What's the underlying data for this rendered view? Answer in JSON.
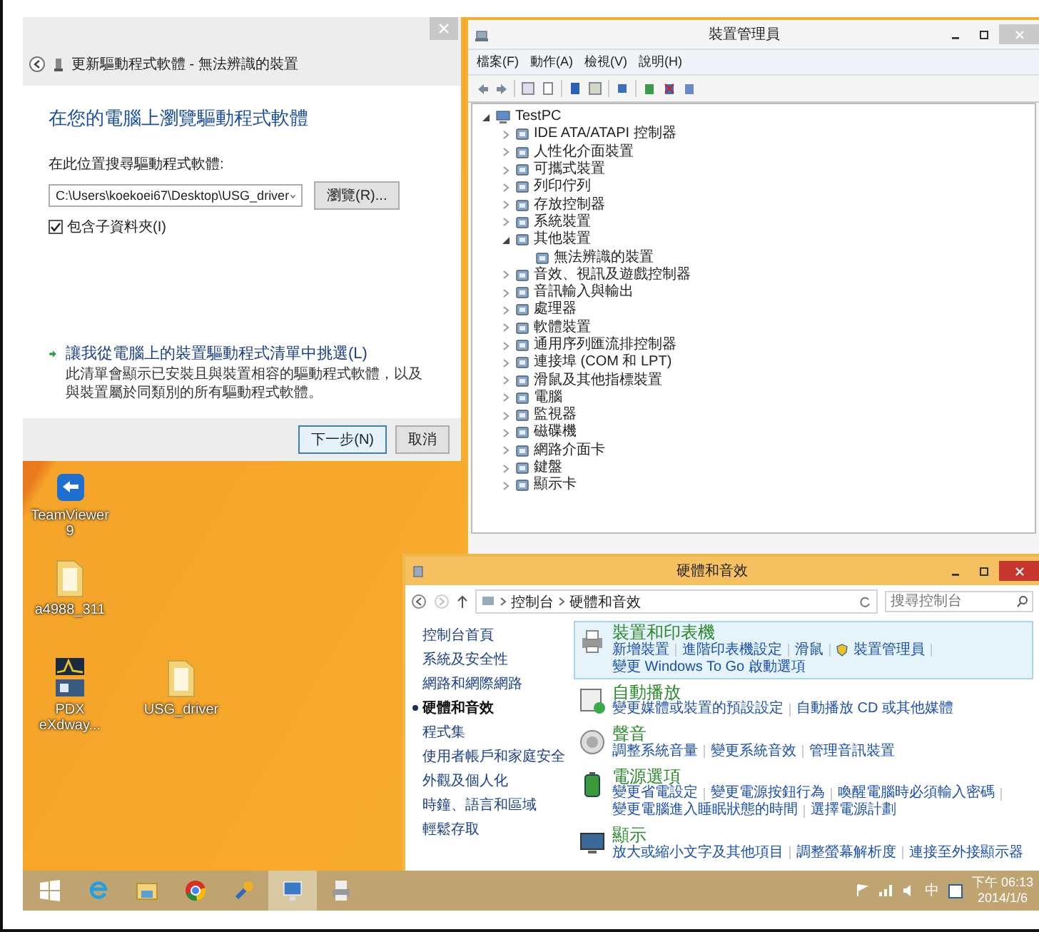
{
  "driver_wizard": {
    "title": "更新驅動程式軟體 - 無法辨識的裝置",
    "heading": "在您的電腦上瀏覽驅動程式軟體",
    "search_label": "在此位置搜尋驅動程式軟體:",
    "path": "C:\\Users\\koekoei67\\Desktop\\USG_driver",
    "browse_button": "瀏覽(R)...",
    "include_subfolders": {
      "label": "包含子資料夾(I)",
      "checked": true
    },
    "pick_link": "讓我從電腦上的裝置驅動程式清單中挑選(L)",
    "pick_description": "此清單會顯示已安裝且與裝置相容的驅動程式軟體，以及與裝置屬於同類別的所有驅動程式軟體。",
    "buttons": [
      {
        "label": "下一步(N)",
        "kind": "primary"
      },
      {
        "label": "取消",
        "kind": "normal"
      }
    ]
  },
  "device_manager": {
    "title": "裝置管理員",
    "menu": [
      "檔案(F)",
      "動作(A)",
      "檢視(V)",
      "說明(H)"
    ],
    "tree": {
      "label": "TestPC",
      "expanded": true,
      "children": [
        {
          "label": "IDE ATA/ATAPI 控制器",
          "expanded": false
        },
        {
          "label": "人性化介面裝置",
          "expanded": false
        },
        {
          "label": "可攜式裝置",
          "expanded": false
        },
        {
          "label": "列印佇列",
          "expanded": false
        },
        {
          "label": "存放控制器",
          "expanded": false
        },
        {
          "label": "系統裝置",
          "expanded": false
        },
        {
          "label": "其他裝置",
          "expanded": true,
          "children": [
            {
              "label": "無法辨識的裝置"
            }
          ]
        },
        {
          "label": "音效、視訊及遊戲控制器",
          "expanded": false
        },
        {
          "label": "音訊輸入與輸出",
          "expanded": false
        },
        {
          "label": "處理器",
          "expanded": false
        },
        {
          "label": "軟體裝置",
          "expanded": false
        },
        {
          "label": "通用序列匯流排控制器",
          "expanded": false
        },
        {
          "label": "連接埠 (COM 和 LPT)",
          "expanded": false
        },
        {
          "label": "滑鼠及其他指標裝置",
          "expanded": false
        },
        {
          "label": "電腦",
          "expanded": false
        },
        {
          "label": "監視器",
          "expanded": false
        },
        {
          "label": "磁碟機",
          "expanded": false
        },
        {
          "label": "網路介面卡",
          "expanded": false
        },
        {
          "label": "鍵盤",
          "expanded": false
        },
        {
          "label": "顯示卡",
          "expanded": false
        }
      ]
    }
  },
  "control_panel": {
    "title": "硬體和音效",
    "breadcrumb": [
      "控制台",
      "硬體和音效"
    ],
    "search": {
      "placeholder": "搜尋控制台"
    },
    "nav": [
      {
        "label": "控制台首頁",
        "selected": false
      },
      {
        "label": "系統及安全性",
        "selected": false
      },
      {
        "label": "網路和網際網路",
        "selected": false
      },
      {
        "label": "硬體和音效",
        "selected": true
      },
      {
        "label": "程式集",
        "selected": false
      },
      {
        "label": "使用者帳戶和家庭安全",
        "selected": false
      },
      {
        "label": "外觀及個人化",
        "selected": false
      },
      {
        "label": "時鐘、語言和區域",
        "selected": false
      },
      {
        "label": "輕鬆存取",
        "selected": false
      }
    ],
    "categories": [
      {
        "title": "裝置和印表機",
        "kind": "printer",
        "selected": true,
        "links": [
          {
            "label": "新增裝置",
            "shield": false
          },
          {
            "label": "進階印表機設定",
            "shield": false
          },
          {
            "label": "滑鼠",
            "shield": false
          },
          {
            "label": "裝置管理員",
            "shield": true
          },
          {
            "label": "變更 Windows To Go 啟動選項",
            "shield": false
          }
        ]
      },
      {
        "title": "自動播放",
        "kind": "autoplay",
        "selected": false,
        "links": [
          {
            "label": "變更媒體或裝置的預設設定",
            "shield": false
          },
          {
            "label": "自動播放 CD 或其他媒體",
            "shield": false
          }
        ]
      },
      {
        "title": "聲音",
        "kind": "sound",
        "selected": false,
        "links": [
          {
            "label": "調整系統音量",
            "shield": false
          },
          {
            "label": "變更系統音效",
            "shield": false
          },
          {
            "label": "管理音訊裝置",
            "shield": false
          }
        ]
      },
      {
        "title": "電源選項",
        "kind": "power",
        "selected": false,
        "links": [
          {
            "label": "變更省電設定",
            "shield": false
          },
          {
            "label": "變更電源按鈕行為",
            "shield": false
          },
          {
            "label": "喚醒電腦時必須輸入密碼",
            "shield": false
          },
          {
            "label": "變更電腦進入睡眠狀態的時間",
            "shield": false
          },
          {
            "label": "選擇電源計劃",
            "shield": false
          }
        ]
      },
      {
        "title": "顯示",
        "kind": "display",
        "selected": false,
        "links": [
          {
            "label": "放大或縮小文字及其他項目",
            "shield": false
          },
          {
            "label": "調整螢幕解析度",
            "shield": false
          },
          {
            "label": "連接至外接顯示器",
            "shield": false
          }
        ]
      }
    ]
  },
  "desktop_icons": [
    {
      "label": "TeamViewer 9",
      "kind": "app"
    },
    {
      "label": "a4988_311",
      "kind": "folder"
    },
    {
      "label": "PDX eXdway...",
      "kind": "chart"
    },
    {
      "label": "USG_driver",
      "kind": "folder"
    }
  ],
  "taskbar": {
    "apps": [
      {
        "kind": "windows",
        "selected": false
      },
      {
        "kind": "browser",
        "selected": false
      },
      {
        "kind": "folder",
        "selected": false
      },
      {
        "kind": "chrome",
        "selected": false
      },
      {
        "kind": "tool",
        "selected": false
      },
      {
        "kind": "devices",
        "selected": true
      },
      {
        "kind": "printer",
        "selected": false
      }
    ],
    "ime": "中",
    "time": "下午 06:13",
    "date": "2014/1/6"
  }
}
